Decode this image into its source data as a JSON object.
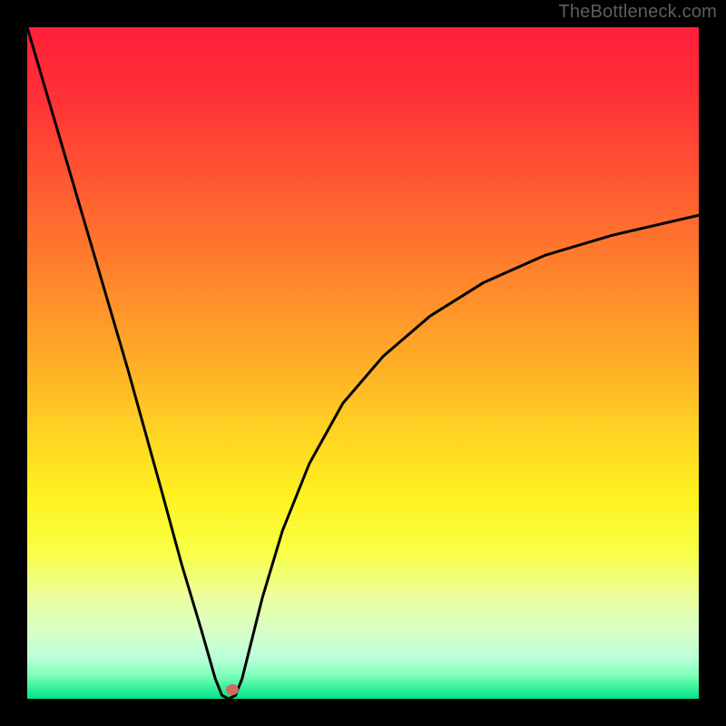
{
  "watermark": "TheBottleneck.com",
  "gradient": {
    "stops": [
      {
        "offset": 0.0,
        "color": "#ff1f3a"
      },
      {
        "offset": 0.1,
        "color": "#ff3037"
      },
      {
        "offset": 0.2,
        "color": "#ff4f33"
      },
      {
        "offset": 0.3,
        "color": "#ff6e2f"
      },
      {
        "offset": 0.4,
        "color": "#ff8e2b"
      },
      {
        "offset": 0.5,
        "color": "#ffae27"
      },
      {
        "offset": 0.6,
        "color": "#ffd223"
      },
      {
        "offset": 0.7,
        "color": "#fff21f"
      },
      {
        "offset": 0.78,
        "color": "#f8ff45"
      },
      {
        "offset": 0.85,
        "color": "#ebffa0"
      },
      {
        "offset": 0.9,
        "color": "#d8ffc8"
      },
      {
        "offset": 0.94,
        "color": "#b8ffd8"
      },
      {
        "offset": 0.965,
        "color": "#7effb8"
      },
      {
        "offset": 0.985,
        "color": "#33f09a"
      },
      {
        "offset": 1.0,
        "color": "#00e389"
      }
    ]
  },
  "chart_data": {
    "type": "line",
    "x": [
      0.0,
      0.05,
      0.1,
      0.15,
      0.2,
      0.23,
      0.26,
      0.28,
      0.29,
      0.3,
      0.31,
      0.32,
      0.33,
      0.35,
      0.38,
      0.42,
      0.47,
      0.53,
      0.6,
      0.68,
      0.77,
      0.87,
      1.0
    ],
    "values": [
      1.0,
      0.83,
      0.66,
      0.49,
      0.31,
      0.2,
      0.1,
      0.03,
      0.005,
      0.0,
      0.005,
      0.03,
      0.07,
      0.15,
      0.25,
      0.35,
      0.44,
      0.51,
      0.57,
      0.62,
      0.66,
      0.69,
      0.72
    ],
    "xlim": [
      0,
      1
    ],
    "ylim": [
      0,
      1
    ],
    "xlabel": "",
    "ylabel": "",
    "title": "",
    "optimum": {
      "x": 0.3,
      "y": 0.0
    }
  },
  "marker": {
    "x_frac": 0.305,
    "y_frac": 0.987
  }
}
